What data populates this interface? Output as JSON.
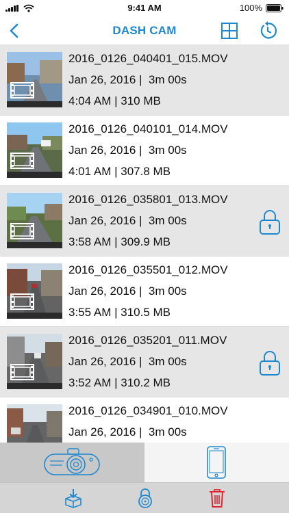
{
  "status_bar": {
    "time": "9:41 AM",
    "battery": "100%"
  },
  "header": {
    "title": "DASH CAM"
  },
  "videos": [
    {
      "filename": "2016_0126_040401_015.MOV",
      "date": "Jan 26, 2016 |",
      "duration": "3m 00s",
      "time_size": "4:04 AM | 310 MB",
      "locked": false
    },
    {
      "filename": "2016_0126_040101_014.MOV",
      "date": "Jan 26, 2016 |",
      "duration": "3m 00s",
      "time_size": "4:01 AM | 307.8 MB",
      "locked": false
    },
    {
      "filename": "2016_0126_035801_013.MOV",
      "date": "Jan 26, 2016 |",
      "duration": "3m 00s",
      "time_size": "3:58 AM | 309.9 MB",
      "locked": true
    },
    {
      "filename": "2016_0126_035501_012.MOV",
      "date": "Jan 26, 2016 |",
      "duration": "3m 00s",
      "time_size": "3:55 AM | 310.5 MB",
      "locked": false
    },
    {
      "filename": "2016_0126_035201_011.MOV",
      "date": "Jan 26, 2016 |",
      "duration": "3m 00s",
      "time_size": "3:52 AM | 310.2 MB",
      "locked": true
    },
    {
      "filename": "2016_0126_034901_010.MOV",
      "date": "Jan 26, 2016 |",
      "duration": "3m 00s",
      "time_size": "",
      "locked": false
    }
  ],
  "tabs": [
    {
      "icon": "dashcam-icon",
      "active": true
    },
    {
      "icon": "phone-icon",
      "active": false
    }
  ],
  "toolbar": [
    {
      "icon": "download-box-icon"
    },
    {
      "icon": "padlock-icon"
    },
    {
      "icon": "trash-icon"
    }
  ],
  "colors": {
    "accent": "#1e88cf",
    "delete": "#e0262e",
    "row_shaded": "#e6e6e6",
    "tab_active": "#c8c8c8",
    "toolbar": "#d5d5d5"
  }
}
